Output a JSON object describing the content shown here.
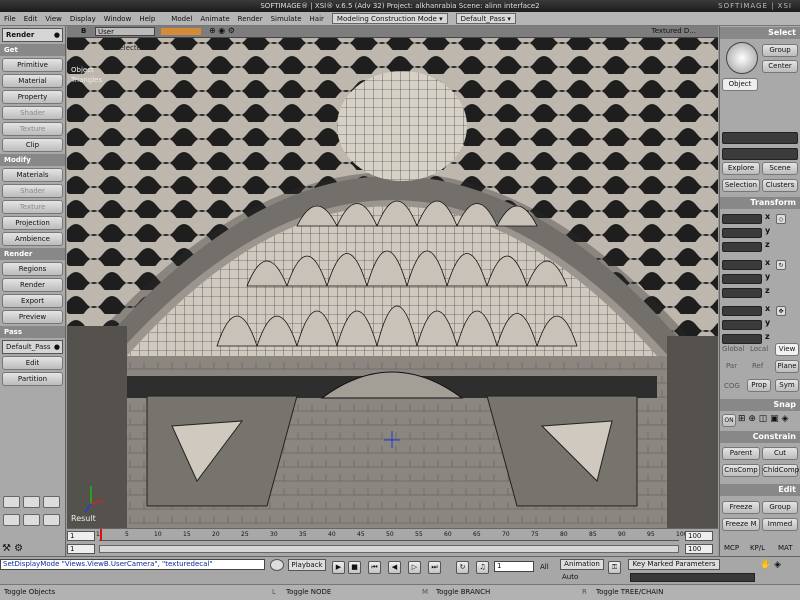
{
  "titlebar": {
    "title": "SOFTIMAGE® | XSI® v.6.5 (Adv 32) Project: alkhanrabia   Scene: alinn interface2",
    "brand": "SOFTIMAGE | XSI"
  },
  "menu": {
    "items": [
      "File",
      "Edit",
      "View",
      "Display",
      "Window",
      "Help",
      "Model",
      "Animate",
      "Render",
      "Simulate",
      "Hair"
    ],
    "mode": "Modeling Construction Mode",
    "pass": "Default_Pass"
  },
  "left": {
    "module": "Render",
    "get": {
      "header": "Get",
      "buttons": [
        "Primitive",
        "Material",
        "Property",
        "Shader",
        "Texture",
        "Clip"
      ]
    },
    "modify": {
      "header": "Modify",
      "buttons": [
        "Materials",
        "Shader",
        "Texture",
        "Projection",
        "Ambience"
      ]
    },
    "render": {
      "header": "Render",
      "buttons": [
        "Regions",
        "Render",
        "Export",
        "Preview"
      ]
    },
    "pass": {
      "header": "Pass",
      "current": "Default_Pass",
      "buttons": [
        "Edit",
        "Partition"
      ]
    }
  },
  "viewport": {
    "letter": "B",
    "camera": "User",
    "display": "Textured D...",
    "overlay1": "Selected",
    "overlay2": "Object",
    "overlay3": "Triangles",
    "result": "Result"
  },
  "right": {
    "select": {
      "header": "Select",
      "group": "Group",
      "center": "Center",
      "object": "Object"
    },
    "explore": "Explore",
    "scene": "Scene",
    "selection": "Selection",
    "clusters": "Clusters",
    "transform": {
      "header": "Transform",
      "axes": [
        "x",
        "y",
        "z"
      ],
      "global": "Global",
      "local": "Local",
      "view": "View",
      "par": "Par",
      "ref": "Ref",
      "plane": "Plane",
      "cog": "COG",
      "prop": "Prop",
      "sym": "Sym"
    },
    "snap": {
      "header": "Snap",
      "on": "ON"
    },
    "constrain": {
      "header": "Constrain",
      "parent": "Parent",
      "cut": "Cut",
      "cnscomp": "CnsComp",
      "chldcomp": "ChldComp"
    },
    "edit": {
      "header": "Edit",
      "freeze": "Freeze",
      "group": "Group",
      "freezem": "Freeze M",
      "immed": "Immed"
    },
    "tabs": [
      "MCP",
      "KP/L",
      "MAT"
    ]
  },
  "timeline": {
    "ticks": [
      "1",
      "5",
      "10",
      "15",
      "20",
      "25",
      "30",
      "35",
      "40",
      "45",
      "50",
      "55",
      "60",
      "65",
      "70",
      "75",
      "80",
      "85",
      "90",
      "95",
      "100"
    ],
    "start": "1",
    "end": "100",
    "start2": "1",
    "end2": "100",
    "current": "1"
  },
  "cmd": {
    "command": "SetDisplayMode \"Views.ViewB.UserCamera\", \"texturedecal\"",
    "playback": "Playback",
    "frame": "1",
    "all": "All",
    "animation": "Animation",
    "auto": "Auto",
    "keymarked": "Key Marked Parameters"
  },
  "status": {
    "s1": "Toggle Objects",
    "s2": "Toggle NODE",
    "s3": "Toggle BRANCH",
    "s4": "Toggle TREE/CHAIN",
    "m1": "L",
    "m2": "M",
    "m3": "R"
  }
}
